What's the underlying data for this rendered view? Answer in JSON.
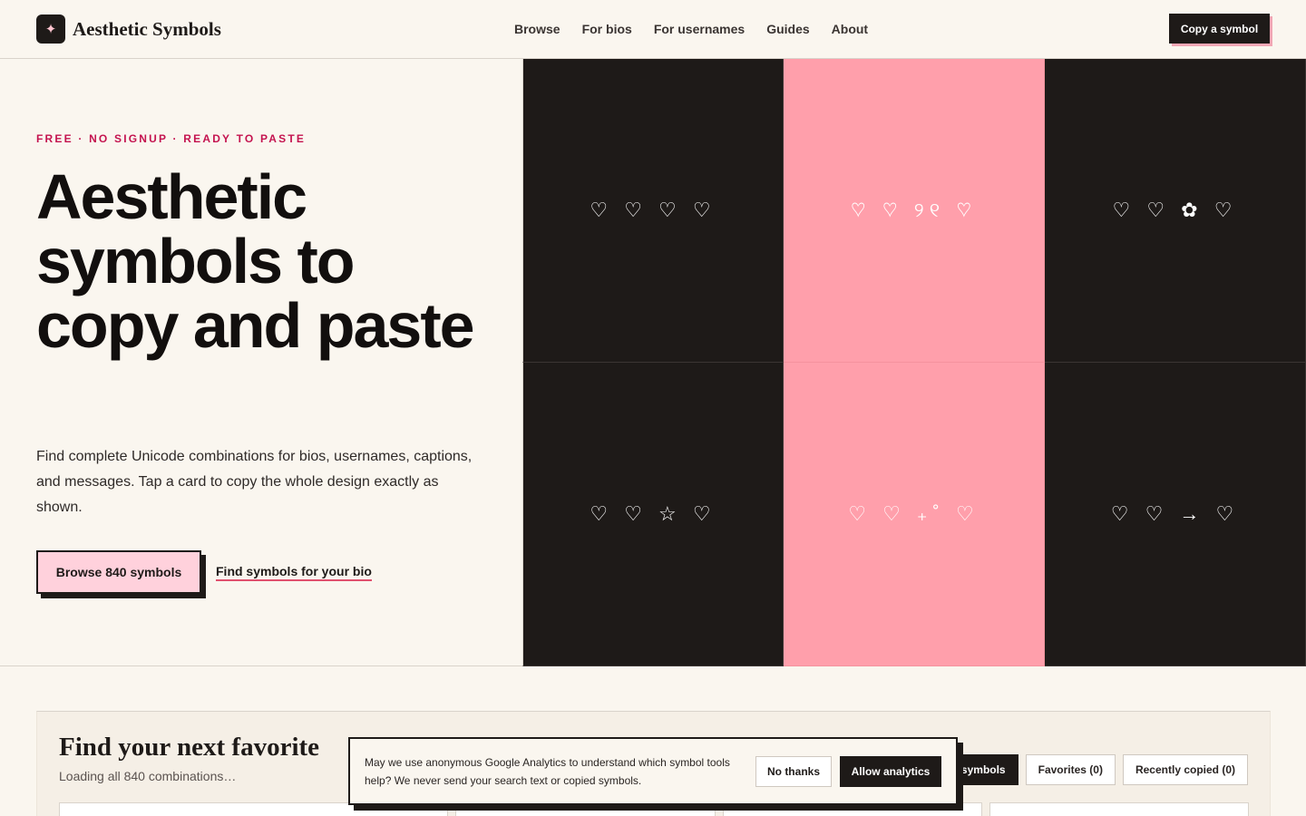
{
  "header": {
    "brand_icon": "sparkle-icon",
    "brand_glyph": "✦",
    "brand_name": "Aesthetic Symbols",
    "nav": [
      "Browse",
      "For bios",
      "For usernames",
      "Guides",
      "About"
    ],
    "cta_label": "Copy a symbol"
  },
  "hero": {
    "eyebrow": "FREE · NO SIGNUP · READY TO PASTE",
    "title": "Aesthetic symbols to copy and paste",
    "description": "Find complete Unicode combinations for bios, usernames, captions, and messages. Tap a card to copy the whole design exactly as shown.",
    "primary_button": "Browse 840 symbols",
    "secondary_link": "Find symbols for your bio",
    "tiles": [
      {
        "symbols": "♡ ♡ ♡ ♡",
        "style": "dark"
      },
      {
        "symbols": "♡ ♡ ୨୧ ♡",
        "style": "pink"
      },
      {
        "symbols": "♡ ♡ ✿ ♡",
        "style": "dark"
      },
      {
        "symbols": "♡ ♡ ☆ ♡",
        "style": "dark"
      },
      {
        "symbols": "♡ ♡ ₊˚ ♡",
        "style": "pink"
      },
      {
        "symbols": "♡ ♡ → ♡",
        "style": "dark"
      }
    ]
  },
  "finder": {
    "title": "Find your next favorite",
    "subtitle": "Loading all 840 combinations…",
    "filters": [
      "symbols",
      "Favorites (0)",
      "Recently copied (0)"
    ]
  },
  "consent": {
    "text": "May we use anonymous Google Analytics to understand which symbol tools help? We never send your search text or copied symbols.",
    "decline": "No thanks",
    "accept": "Allow analytics"
  },
  "colors": {
    "ink": "#1e1a18",
    "accent_pink": "#ff9fab",
    "light_pink": "#ffd1dc",
    "eyebrow_red": "#c4134f",
    "paper": "#faf6ef"
  }
}
